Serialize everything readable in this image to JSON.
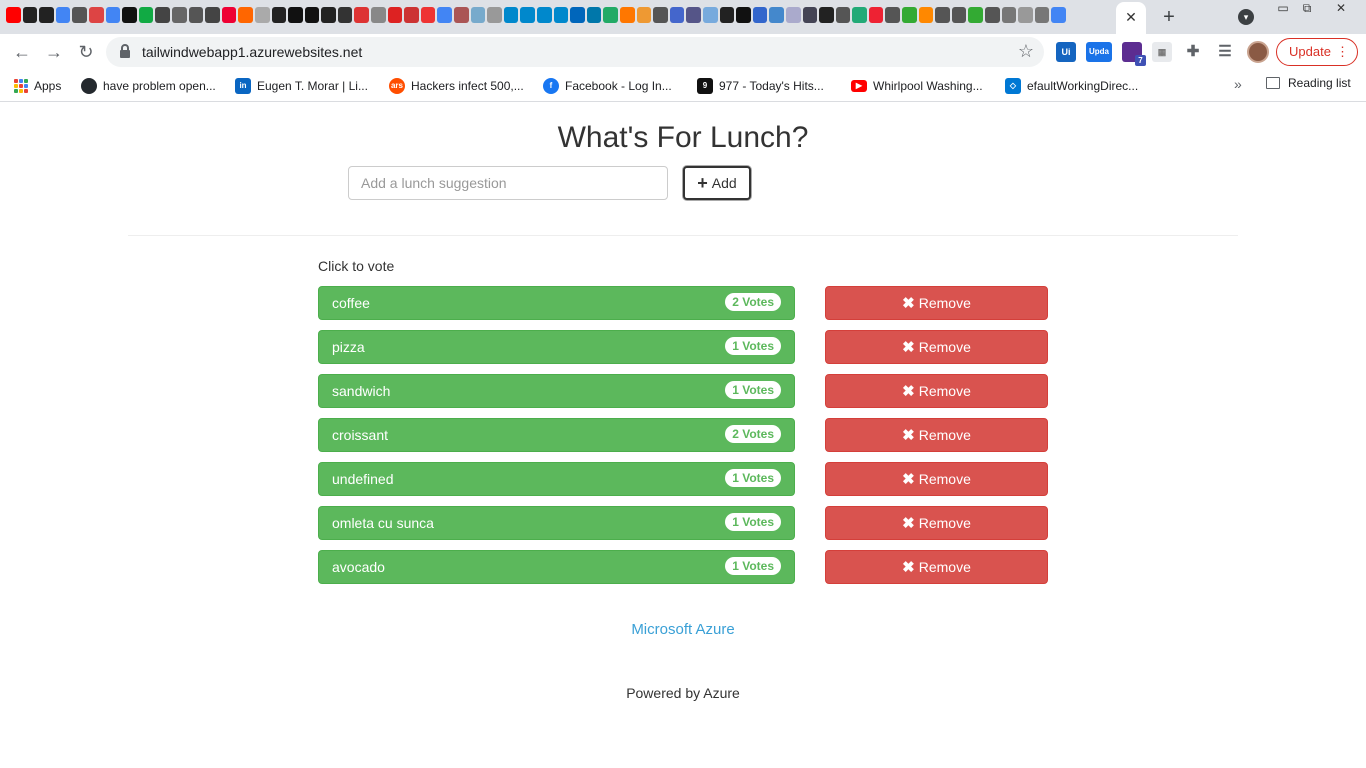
{
  "browser": {
    "url": "tailwindwebapp1.azurewebsites.net",
    "update_label": "Update",
    "extension_badge": "7",
    "extension_updater_label": "Upda",
    "extension_ui_label": "Ui",
    "bookmarks": [
      {
        "label": "Apps",
        "icon": "apps-grid-icon"
      },
      {
        "label": "have problem open...",
        "icon": "github-icon",
        "color": "#24292e"
      },
      {
        "label": "Eugen T. Morar | Li...",
        "icon": "linkedin-icon",
        "color": "#0a66c2"
      },
      {
        "label": "Hackers infect 500,...",
        "icon": "ars-technica-icon",
        "color": "#ff4e00"
      },
      {
        "label": "Facebook - Log In...",
        "icon": "facebook-icon",
        "color": "#1877f2"
      },
      {
        "label": "977 - Today's Hits...",
        "icon": "radio-icon",
        "color": "#111111"
      },
      {
        "label": "Whirlpool Washing...",
        "icon": "youtube-icon",
        "color": "#ff0000"
      },
      {
        "label": "efaultWorkingDirec...",
        "icon": "visual-studio-icon",
        "color": "#0078d4"
      }
    ],
    "reading_list_label": "Reading list",
    "tab_favicon_colors": [
      "#ff0000",
      "#222",
      "#222",
      "#4285f4",
      "#555",
      "#d44",
      "#4285f4",
      "#111",
      "#1a4",
      "#444",
      "#666",
      "#555",
      "#444",
      "#e03",
      "#f60",
      "#aaa",
      "#222",
      "#111",
      "#111",
      "#222",
      "#333",
      "#d33",
      "#888",
      "#d22",
      "#c33",
      "#e33",
      "#4285f4",
      "#a55",
      "#7ac",
      "#999",
      "#08c",
      "#08c",
      "#08c",
      "#08c",
      "#06b",
      "#07a",
      "#2a6",
      "#f70",
      "#e93",
      "#555",
      "#46c",
      "#558",
      "#7ad",
      "#222",
      "#111",
      "#36c",
      "#48c",
      "#aac",
      "#445",
      "#222",
      "#555",
      "#2a7",
      "#e23",
      "#555",
      "#3a3",
      "#f80",
      "#555",
      "#555",
      "#3a3",
      "#555",
      "#777",
      "#999",
      "#777",
      "#4285f4"
    ]
  },
  "page": {
    "title": "What's For Lunch?",
    "input_placeholder": "Add a lunch suggestion",
    "add_label": "Add",
    "instructions": "Click to vote",
    "remove_label": "Remove",
    "items": [
      {
        "name": "coffee",
        "votes": "2 Votes"
      },
      {
        "name": "pizza",
        "votes": "1 Votes"
      },
      {
        "name": "sandwich",
        "votes": "1 Votes"
      },
      {
        "name": "croissant",
        "votes": "2 Votes"
      },
      {
        "name": "undefined",
        "votes": "1 Votes"
      },
      {
        "name": "omleta cu sunca",
        "votes": "1 Votes"
      },
      {
        "name": "avocado",
        "votes": "1 Votes"
      }
    ],
    "footer_link": "Microsoft Azure",
    "footer_text": "Powered by Azure"
  },
  "colors": {
    "vote_green": "#5cb85c",
    "remove_red": "#d9534f",
    "link_blue": "#3aa0d6"
  }
}
